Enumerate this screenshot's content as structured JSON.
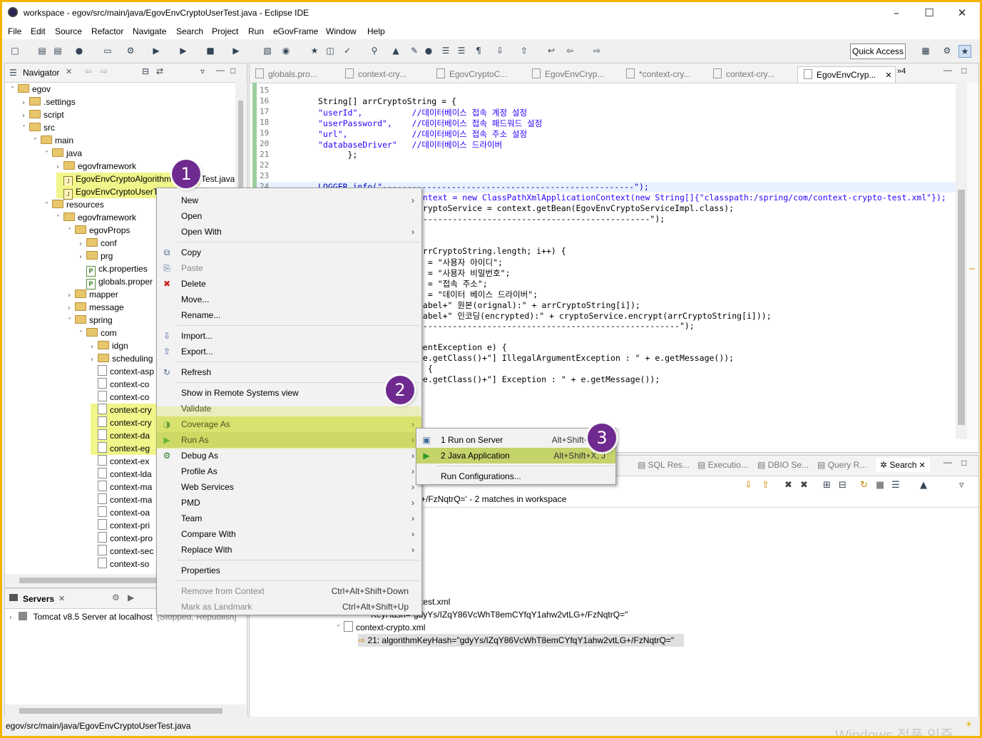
{
  "window": {
    "title": "workspace - egov/src/main/java/EgovEnvCryptoUserTest.java - Eclipse IDE"
  },
  "menu": [
    "File",
    "Edit",
    "Source",
    "Refactor",
    "Navigate",
    "Search",
    "Project",
    "Run",
    "eGovFrame",
    "Window",
    "Help"
  ],
  "quick_access": "Quick Access",
  "navigator": {
    "title": "Navigator",
    "tree": [
      {
        "label": "egov",
        "type": "project",
        "tw": "v"
      },
      {
        "label": ".settings",
        "type": "folder",
        "tw": ">"
      },
      {
        "label": "script",
        "type": "folder",
        "tw": ">"
      },
      {
        "label": "src",
        "type": "folder",
        "tw": "v"
      },
      {
        "label": "main",
        "type": "folder",
        "tw": "v"
      },
      {
        "label": "java",
        "type": "folder",
        "tw": "v"
      },
      {
        "label": "egovframework",
        "type": "folder",
        "tw": ">"
      },
      {
        "label": "EgovEnvCryptoAlgorithm",
        "type": "java",
        "tw": "",
        "hl": true
      },
      {
        "label": "EgovEnvCryptoUserT",
        "type": "java",
        "tw": "",
        "hl": true
      },
      {
        "label": "resources",
        "type": "folder",
        "tw": "v"
      },
      {
        "label": "egovframework",
        "type": "folder",
        "tw": "v"
      },
      {
        "label": "egovProps",
        "type": "folder",
        "tw": "v"
      },
      {
        "label": "conf",
        "type": "folder",
        "tw": ">"
      },
      {
        "label": "prg",
        "type": "folder",
        "tw": ">"
      },
      {
        "label": "ck.properties",
        "type": "prop",
        "tw": ""
      },
      {
        "label": "globals.proper",
        "type": "prop",
        "tw": ""
      },
      {
        "label": "mapper",
        "type": "folder",
        "tw": ">"
      },
      {
        "label": "message",
        "type": "folder",
        "tw": ">"
      },
      {
        "label": "spring",
        "type": "folder",
        "tw": "v"
      },
      {
        "label": "com",
        "type": "folder",
        "tw": "v"
      },
      {
        "label": "idgn",
        "type": "folder",
        "tw": ">"
      },
      {
        "label": "scheduling",
        "type": "folder",
        "tw": ">"
      },
      {
        "label": "context-asp",
        "type": "xml",
        "tw": ""
      },
      {
        "label": "context-co",
        "type": "xml",
        "tw": ""
      },
      {
        "label": "context-co",
        "type": "xml",
        "tw": ""
      },
      {
        "label": "context-cry",
        "type": "xml",
        "tw": "",
        "hl": true
      },
      {
        "label": "context-cry",
        "type": "xml",
        "tw": "",
        "hl": true
      },
      {
        "label": "context-da",
        "type": "xml",
        "tw": "",
        "hl": true
      },
      {
        "label": "context-eg",
        "type": "xml",
        "tw": "",
        "hl": true
      },
      {
        "label": "context-ex",
        "type": "xml",
        "tw": ""
      },
      {
        "label": "context-lda",
        "type": "xml",
        "tw": ""
      },
      {
        "label": "context-ma",
        "type": "xml",
        "tw": ""
      },
      {
        "label": "context-ma",
        "type": "xml",
        "tw": ""
      },
      {
        "label": "context-oa",
        "type": "xml",
        "tw": ""
      },
      {
        "label": "context-pri",
        "type": "xml",
        "tw": ""
      },
      {
        "label": "context-pro",
        "type": "xml",
        "tw": ""
      },
      {
        "label": "context-sec",
        "type": "xml",
        "tw": ""
      },
      {
        "label": "context-so",
        "type": "xml",
        "tw": ""
      }
    ],
    "test_java_suffix": "Test.java"
  },
  "servers": {
    "title": "Servers",
    "item": "Tomcat v8.5 Server at localhost",
    "state": "[Stopped, Republish]"
  },
  "editor": {
    "tabs": [
      "globals.pro...",
      "context-cry...",
      "EgovCryptoC...",
      "EgovEnvCryp...",
      "*context-cry...",
      "context-cry...",
      "EgovEnvCryp..."
    ],
    "overflow": "»4",
    "lines": [
      {
        "n": "15",
        "t": ""
      },
      {
        "n": "16",
        "t": "String[] arrCryptoString = {"
      },
      {
        "n": "17",
        "t": "\"userId\",          //데이터베이스 접속 계정 설정"
      },
      {
        "n": "18",
        "t": "\"userPassword\",    //데이터베이스 접속 패드워드 설정"
      },
      {
        "n": "19",
        "t": "\"url\",             //데이터베이스 접속 주소 설정"
      },
      {
        "n": "20",
        "t": "\"databaseDriver\"   //데이터베이스 드라이버"
      },
      {
        "n": "21",
        "t": "      };"
      },
      {
        "n": "22",
        "t": ""
      },
      {
        "n": "23",
        "t": ""
      },
      {
        "n": "24",
        "t": "LOGGER.info(\"---------------------------------------------------\");"
      }
    ],
    "partial_lines": [
      "ontext = new ClassPathXmlApplicationContext(new String[]{\"classpath:/spring/com/context-crypto-test.xml\"});",
      "cryptoService = context.getBean(EgovEnvCryptoServiceImpl.class);",
      "-----------------------------------------------\");",
      "",
      "",
      "arrCryptoString.length; i++) {",
      "l = \"사용자 아이디\";",
      "l = \"사용자 비밀번호\";",
      "l = \"접속 주소\";",
      "l = \"데이터 베이스 드라이버\";",
      "label+\" 원본(orignal):\" + arrCryptoString[i]);",
      "label+\" 인코딩(encrypted):\" + cryptoService.encrypt(arrCryptoString[i]));",
      "\"----------------------------------------------------\");",
      "",
      "mentException e) {",
      "+e.getClass()+\"] IllegalArgumentException : \" + e.getMessage());",
      ") {",
      "+e.getClass()+\"] Exception : \" + e.getMessage());"
    ]
  },
  "bottom": {
    "tabs": [
      "SQL Res...",
      "Executio...",
      "DBIO Se...",
      "Query R...",
      "Search"
    ],
    "summary": "+/FzNqtrQ=' - 2 matches in workspace",
    "results": [
      {
        "label": "test.xml",
        "indent": 0
      },
      {
        "label": "KeyHash=\"gdyYs/IZqY86VcWhT8emCYfqY1ahw2vtLG+/FzNqtrQ=\"",
        "indent": 1
      },
      {
        "label": "context-crypto.xml",
        "indent": 0
      },
      {
        "label": "21: algorithmKeyHash=\"gdyYs/IZqY86VcWhT8emCYfqY1ahw2vtLG+/FzNqtrQ=\"",
        "indent": 1
      }
    ]
  },
  "context_menu": {
    "items": [
      {
        "label": "New",
        "sub": true
      },
      {
        "label": "Open"
      },
      {
        "label": "Open With",
        "sub": true
      },
      {
        "sep": true
      },
      {
        "label": "Copy",
        "icon": "copy-icon"
      },
      {
        "label": "Paste",
        "icon": "paste-icon",
        "disabled": true
      },
      {
        "label": "Delete",
        "icon": "delete-icon"
      },
      {
        "label": "Move..."
      },
      {
        "label": "Rename..."
      },
      {
        "sep": true
      },
      {
        "label": "Import...",
        "icon": "import-icon"
      },
      {
        "label": "Export...",
        "icon": "export-icon"
      },
      {
        "sep": true
      },
      {
        "label": "Refresh",
        "icon": "refresh-icon"
      },
      {
        "sep": true
      },
      {
        "label": "Show in Remote Systems view"
      },
      {
        "label": "Validate"
      },
      {
        "label": "Coverage As",
        "sub": true,
        "icon": "coverage-icon"
      },
      {
        "label": "Run As",
        "sub": true,
        "icon": "run-icon",
        "active": true
      },
      {
        "label": "Debug As",
        "sub": true,
        "icon": "debug-icon"
      },
      {
        "label": "Profile As",
        "sub": true
      },
      {
        "label": "Web Services",
        "sub": true
      },
      {
        "label": "PMD",
        "sub": true
      },
      {
        "label": "Team",
        "sub": true
      },
      {
        "label": "Compare With",
        "sub": true
      },
      {
        "label": "Replace With",
        "sub": true
      },
      {
        "sep": true
      },
      {
        "label": "Properties"
      },
      {
        "sep": true
      },
      {
        "label": "Remove from Context",
        "shortcut": "Ctrl+Alt+Shift+Down",
        "disabled": true
      },
      {
        "label": "Mark as Landmark",
        "shortcut": "Ctrl+Alt+Shift+Up",
        "disabled": true
      }
    ]
  },
  "run_as_menu": {
    "items": [
      {
        "label": "1 Run on Server",
        "shortcut": "Alt+Shift+X, R"
      },
      {
        "label": "2 Java Application",
        "shortcut": "Alt+Shift+X, J",
        "active": true
      },
      {
        "label": "Run Configurations..."
      }
    ]
  },
  "badges": [
    "1",
    "2",
    "3"
  ],
  "status": {
    "path": "egov/src/main/java/EgovEnvCryptoUserTest.java"
  },
  "watermark": "Windows 정품 인증"
}
